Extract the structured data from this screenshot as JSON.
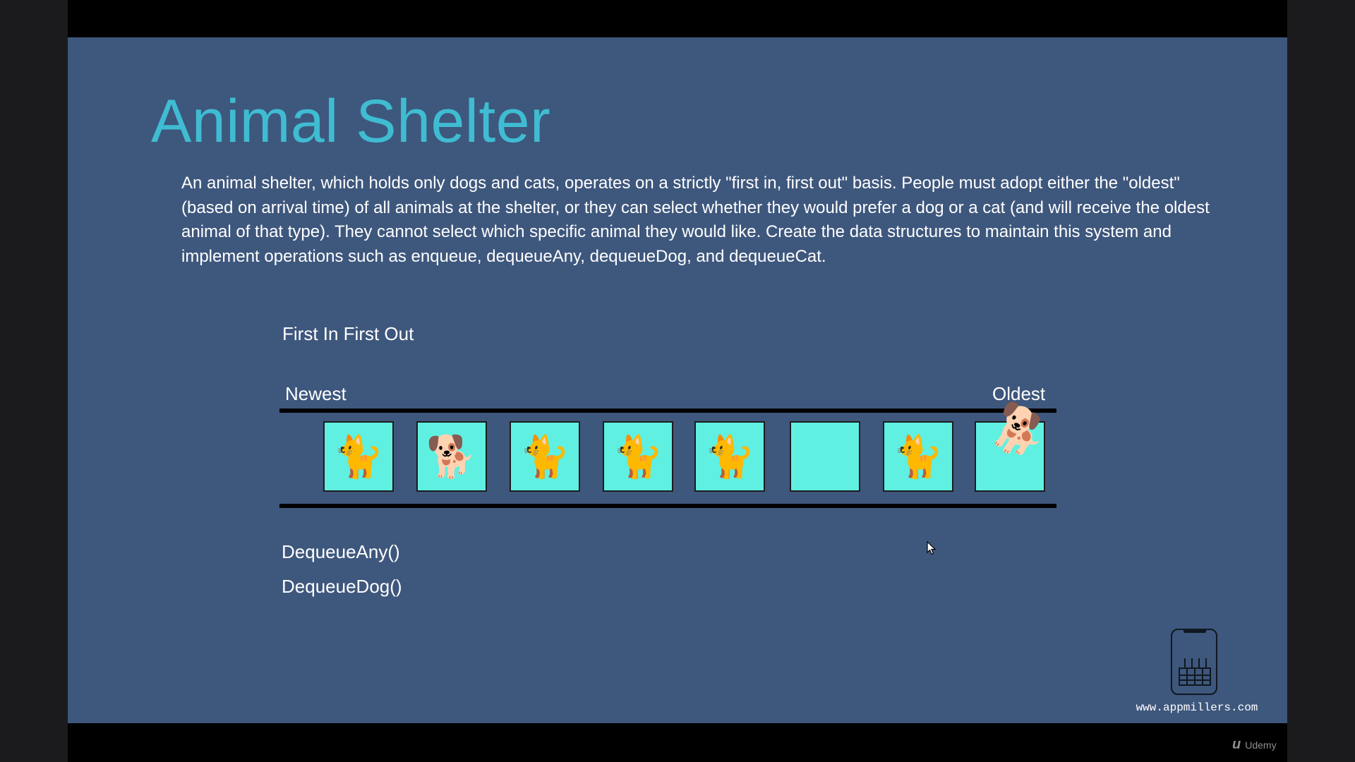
{
  "slide": {
    "title": "Animal Shelter",
    "description": "An animal shelter, which holds only dogs and cats, operates on a strictly \"first in, first out\" basis. People must adopt either the \"oldest\" (based on arrival time) of all animals at the shelter, or they can select whether they would prefer a dog or a cat (and will receive the oldest animal of that type). They cannot select which specific animal they would like. Create the data structures to maintain this system and implement operations such as enqueue, dequeueAny, dequeueDog, and dequeueCat.",
    "fifo_label": "First In First Out",
    "newest_label": "Newest",
    "oldest_label": "Oldest",
    "queue": [
      {
        "animal": "cat",
        "glyph": "🐈"
      },
      {
        "animal": "dog",
        "glyph": "🐕"
      },
      {
        "animal": "cat",
        "glyph": "🐈"
      },
      {
        "animal": "cat",
        "glyph": "🐈"
      },
      {
        "animal": "cat",
        "glyph": "🐈"
      },
      {
        "animal": "empty",
        "glyph": ""
      },
      {
        "animal": "cat",
        "glyph": "🐈"
      },
      {
        "animal": "dog-leaving",
        "glyph": "🐕"
      }
    ],
    "operations": [
      "DequeueAny()",
      "DequeueDog()"
    ],
    "colors": {
      "background": "#3e577d",
      "title": "#3fbcd2",
      "cell": "#5ff0e2"
    }
  },
  "logo": {
    "url": "www.appmillers.com",
    "icon": "factory-icon"
  },
  "watermark": {
    "text": "Udemy",
    "icon": "udemy-logo-icon"
  }
}
